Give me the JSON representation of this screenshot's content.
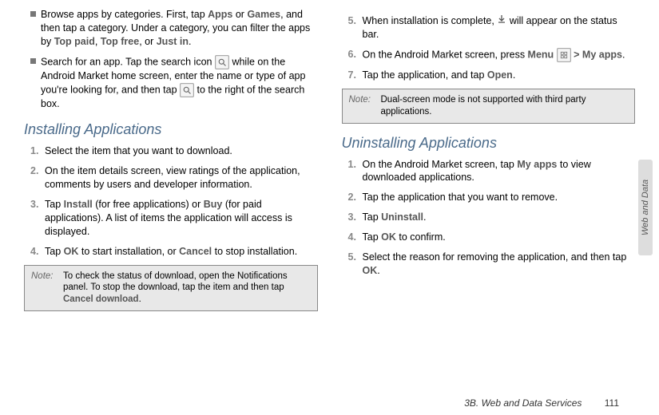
{
  "left": {
    "bullet1_a": "Browse apps by categories. First, tap ",
    "bullet1_b": "Apps",
    "bullet1_c": " or ",
    "bullet1_d": "Games",
    "bullet1_e": ", and then tap a category. Under a category, you can filter the apps by ",
    "bullet1_f": "Top paid",
    "bullet1_g": ", ",
    "bullet1_h": "Top free",
    "bullet1_i": ", or ",
    "bullet1_j": "Just in",
    "bullet1_k": ".",
    "bullet2_a": "Search for an app. Tap the search icon ",
    "bullet2_b": " while on the Android Market home screen, enter the name or type of app you're looking for, and then tap ",
    "bullet2_c": " to the right of the search box.",
    "heading1": "Installing Applications",
    "step1": "Select the item that you want to download.",
    "step2": "On the item details screen, view ratings of the application, comments by users and developer information.",
    "step3_a": "Tap ",
    "step3_b": "Install",
    "step3_c": " (for free applications) or ",
    "step3_d": "Buy",
    "step3_e": " (for paid applications). A list of items the application will access is displayed.",
    "step4_a": "Tap ",
    "step4_b": "OK",
    "step4_c": " to start installation, or ",
    "step4_d": "Cancel",
    "step4_e": " to stop installation.",
    "note_label": "Note:",
    "note1_a": "To check the status of download, open the Notifications panel. To stop the download, tap the item and then tap ",
    "note1_b": "Cancel download",
    "note1_c": "."
  },
  "right": {
    "step5_a": "When installation is complete, ",
    "step5_b": " will appear on the status bar.",
    "step6_a": "On the Android Market screen, press ",
    "step6_b": "Menu",
    "step6_c": " > ",
    "step6_d": "My apps",
    "step6_e": ".",
    "step7_a": "Tap the application, and tap ",
    "step7_b": "Open",
    "step7_c": ".",
    "note_label": "Note:",
    "note2": "Dual-screen mode is not supported with third party applications.",
    "heading2": "Uninstalling Applications",
    "u1_a": "On the Android Market screen, tap ",
    "u1_b": "My apps",
    "u1_c": " to view downloaded applications.",
    "u2": "Tap the application that you want to remove.",
    "u3_a": "Tap ",
    "u3_b": "Uninstall",
    "u3_c": ".",
    "u4_a": "Tap ",
    "u4_b": "OK",
    "u4_c": " to confirm.",
    "u5_a": "Select the reason for removing the application, and then tap ",
    "u5_b": "OK",
    "u5_c": "."
  },
  "nums": {
    "n1": "1.",
    "n2": "2.",
    "n3": "3.",
    "n4": "4.",
    "n5": "5.",
    "n6": "6.",
    "n7": "7."
  },
  "side_tab": "Web and Data",
  "footer_title": "3B. Web and Data Services",
  "footer_page": "111"
}
